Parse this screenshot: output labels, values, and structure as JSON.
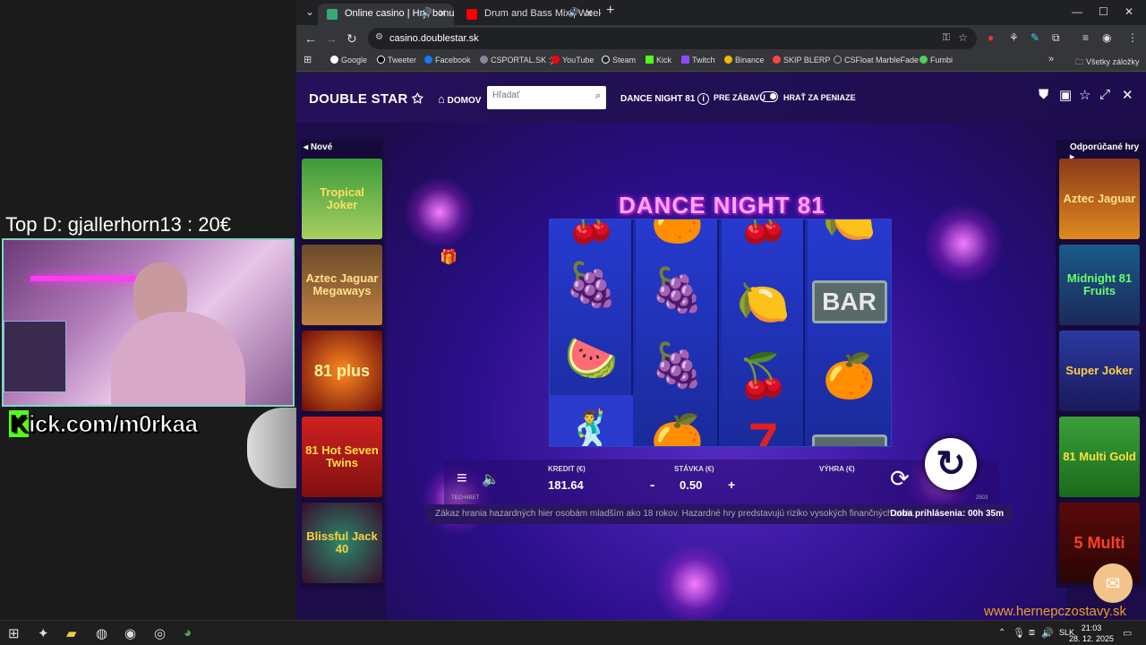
{
  "stream": {
    "top_donor": "Top D: gjallerhorn13 : 20€",
    "kick_prefix": "K",
    "kick_rest": "ick.com/m0rkaa"
  },
  "browser": {
    "tabs": [
      {
        "title": "Online casino | Hry, bonusy"
      },
      {
        "title": "Drum and Bass Mix | Week"
      }
    ],
    "url": "casino.doublestar.sk",
    "bookmarks": [
      "Google",
      "Tweeter",
      "Facebook",
      "CSPORTAL.SK :)",
      "YouTube",
      "Steam",
      "Kick",
      "Twitch",
      "Binance",
      "SKIP BLERP",
      "CSFloat MarbleFade",
      "Fumbi"
    ],
    "all_bookmarks": "Všetky záložky"
  },
  "site": {
    "logo": "DOUBLE STAR",
    "home": "DOMOV",
    "search_placeholder": "Hľadať",
    "game_name": "DANCE NIGHT 81",
    "mode_free": "PRE ZÁBAVU",
    "mode_real": "HRAŤ ZA PENIAZE",
    "left_label": "Nové",
    "right_label": "Odporúčané hry"
  },
  "left_games": [
    "Tropical Joker",
    "Aztec Jaguar Megaways",
    "81 plus",
    "81 Hot Seven Twins",
    "Blissful Jack 40"
  ],
  "right_games": [
    "Aztec Jaguar",
    "Midnight 81 Fruits",
    "Super Joker",
    "81 Multi Gold",
    "5 Multi"
  ],
  "game": {
    "title": "DANCE NIGHT 81",
    "reels": [
      [
        "🍒",
        "🍇",
        "🍉",
        "🕺"
      ],
      [
        "🍊",
        "🍇",
        "🍇",
        "🍊"
      ],
      [
        "🍒",
        "🍋",
        "🍒",
        "7"
      ],
      [
        "🍋",
        "BAR",
        "🍊",
        "BAR"
      ]
    ],
    "credit_label": "KREDIT (€)",
    "credit_value": "181.64",
    "bet_label": "STÁVKA (€)",
    "bet_value": "0.50",
    "win_label": "VÝHRA (€)",
    "provider": "TECH4BET",
    "build": "2503"
  },
  "disclaimer": "Zákaz hrania hazardných hier osobám mladším ako 18 rokov. Hazardné hry predstavujú riziko vysokých finančných strát.",
  "session": "Doba prihlásenia: 00h 35m",
  "watermark": "www.hernepczostavy.sk",
  "taskbar": {
    "lang": "SLK",
    "time": "21:03",
    "date": "28. 12. 2025"
  }
}
